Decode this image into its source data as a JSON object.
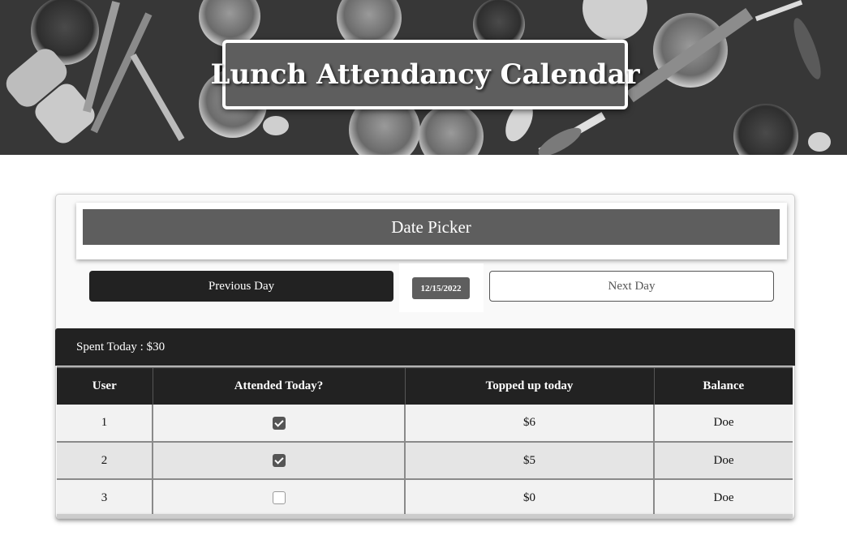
{
  "banner": {
    "title": "Lunch Attendancy Calendar"
  },
  "date_picker": {
    "header": "Date Picker",
    "prev_label": "Previous Day",
    "date_value": "12/15/2022",
    "next_label": "Next Day"
  },
  "summary": {
    "spent_today": "Spent Today : $30"
  },
  "table": {
    "headers": [
      "User",
      "Attended Today?",
      "Topped up today",
      "Balance"
    ],
    "rows": [
      {
        "user": "1",
        "attended": true,
        "topped_up": "$6",
        "balance": "Doe"
      },
      {
        "user": "2",
        "attended": true,
        "topped_up": "$5",
        "balance": "Doe"
      },
      {
        "user": "3",
        "attended": false,
        "topped_up": "$0",
        "balance": "Doe"
      }
    ]
  },
  "colors": {
    "dark": "#222222",
    "header_gray": "#5e5e5e",
    "row_light": "#f2f2f2",
    "row_dark": "#e5e5e5"
  },
  "icons": {
    "checked": "checkbox-checked-icon",
    "unchecked": "checkbox-unchecked-icon"
  }
}
